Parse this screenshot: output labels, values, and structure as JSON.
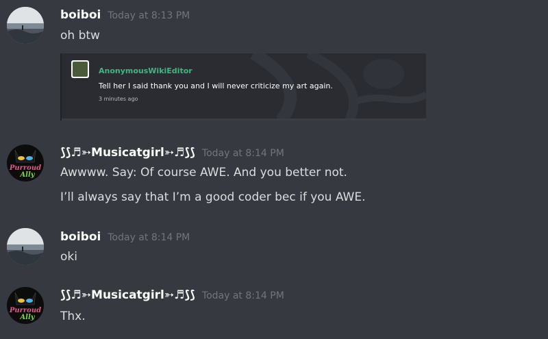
{
  "messages": [
    {
      "username": "boiboi",
      "timestamp": "Today at 8:13 PM",
      "lines": [
        "oh btw"
      ],
      "embed": {
        "author": "AnonymousWikiEditor",
        "text": "Tell her I said thank you and I will never criticize my art again.",
        "time": "3 minutes ago"
      }
    },
    {
      "username": "⟆⟆♬➳Musicatgirl➳♬⟆⟆",
      "timestamp": "Today at 8:14 PM",
      "lines": [
        "Awwww. Say: Of course AWE. And you better not.",
        "I’ll always say that I’m a good coder bec if you AWE."
      ]
    },
    {
      "username": "boiboi",
      "timestamp": "Today at 8:14 PM",
      "lines": [
        "oki"
      ]
    },
    {
      "username": "⟆⟆♬➳Musicatgirl➳♬⟆⟆",
      "timestamp": "Today at 8:14 PM",
      "lines": [
        "Thx."
      ]
    }
  ],
  "avatars": {
    "boiboi": "beach-landscape-avatar",
    "musicatgirl": "purroud-ally-cat-avatar",
    "musicatgirl_text": "Purroud Ally"
  },
  "colors": {
    "background": "#36393f",
    "username": "#ffffff",
    "timestamp": "#72767d",
    "message_text": "#dcddde",
    "embed_author": "#43b581"
  }
}
